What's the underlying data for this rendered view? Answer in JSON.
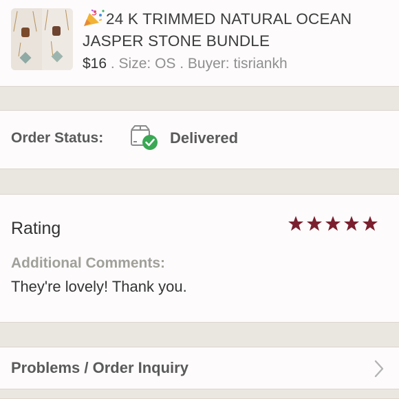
{
  "product": {
    "title": "24 K TRIMMED NATURAL OCEAN JASPER STONE BUNDLE",
    "title_icon": "party-popper-icon",
    "price": "$16",
    "details": " . Size: OS . Buyer: tisriankh"
  },
  "order": {
    "status_label": "Order Status:",
    "status_icon": "delivered-box-check-icon",
    "status_value": "Delivered"
  },
  "rating": {
    "title": "Rating",
    "stars": 5,
    "star_color": "#7b1f2e",
    "comments_label": "Additional Comments:",
    "comments_text": "They're lovely! Thank you."
  },
  "support": {
    "problems_label": "Problems / Order Inquiry",
    "chevron_icon": "chevron-right-icon"
  },
  "colors": {
    "background": "#eeeae5",
    "card": "#fdfbfb",
    "success": "#3aa855"
  }
}
